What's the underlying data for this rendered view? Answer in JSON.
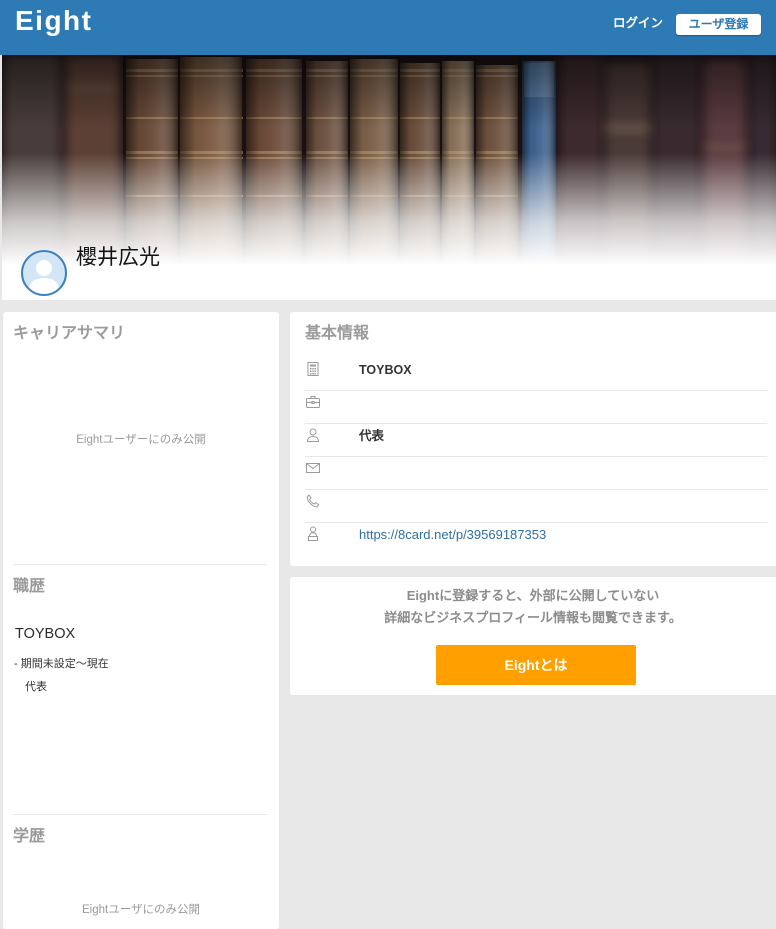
{
  "header": {
    "logo": "Eight",
    "login": "ログイン",
    "signup": "ユーザ登録"
  },
  "profile": {
    "name": "櫻井広光",
    "avatar_icon": "default-user-avatar-icon",
    "cover_icon": "bookshelf-photo"
  },
  "career": {
    "summary_heading": "キャリアサマリ",
    "summary_notice": "Eightユーザーにのみ公開",
    "history_heading": "職歴",
    "history": [
      {
        "company": "TOYBOX",
        "period": "- 期間未設定〜現在",
        "position": "代表"
      }
    ],
    "education_heading": "学歴",
    "education_notice": "Eightユーザにのみ公開"
  },
  "basic_info": {
    "heading": "基本情報",
    "rows": [
      {
        "icon": "building-icon",
        "value": "TOYBOX"
      },
      {
        "icon": "briefcase-icon",
        "value": ""
      },
      {
        "icon": "person-icon",
        "value": "代表"
      },
      {
        "icon": "mail-icon",
        "value": ""
      },
      {
        "icon": "phone-icon",
        "value": ""
      },
      {
        "icon": "profile-url-icon",
        "value": "https://8card.net/p/39569187353"
      }
    ]
  },
  "promo": {
    "line1": "Eightに登録すると、外部に公開していない",
    "line2": "詳細なビジネスプロフィール情報も閲覧できます。",
    "button": "Eightとは"
  },
  "colors": {
    "header_bg": "#2d7ab5",
    "signup_text": "#2d7ab5",
    "cta_button": "#ffa000",
    "link": "#2f6ea5",
    "heading_gray": "#9b9b9b",
    "page_bg": "#e8e8e8"
  }
}
